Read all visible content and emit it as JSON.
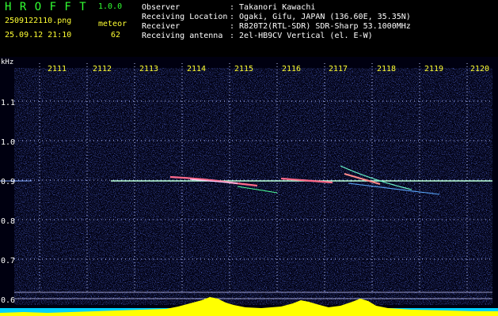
{
  "app": {
    "name": "H R O F F T",
    "version": "1.0.0",
    "filename": "2509122110.png",
    "datetime": "25.09.12 21:10",
    "counter_label": "meteor",
    "counter_value": "62"
  },
  "info": [
    {
      "key": "Observer",
      "value": ": Takanori Kawachi"
    },
    {
      "key": "Receiving Location",
      "value": ": Ogaki, Gifu, JAPAN (136.60E, 35.35N)"
    },
    {
      "key": "Receiver",
      "value": ": R820T2(RTL-SDR) SDR-Sharp 53.1000MHz"
    },
    {
      "key": "Receiving antenna",
      "value": ": 2el-HB9CV Vertical (el. E-W)"
    }
  ],
  "y_axis": {
    "unit": "kHz",
    "ticks": [
      "1.1",
      "1.0",
      "0.9",
      "0.8",
      "0.7",
      "0.6"
    ]
  },
  "x_axis": {
    "ticks": [
      "2111",
      "2112",
      "2113",
      "2114",
      "2115",
      "2116",
      "2117",
      "2118",
      "2119",
      "2120"
    ]
  },
  "colors": {
    "title": "#32ff32",
    "text": "#ffffff",
    "highlight": "#ffff33",
    "grid": "#b8c4ff",
    "signal": "#ffff00"
  }
}
